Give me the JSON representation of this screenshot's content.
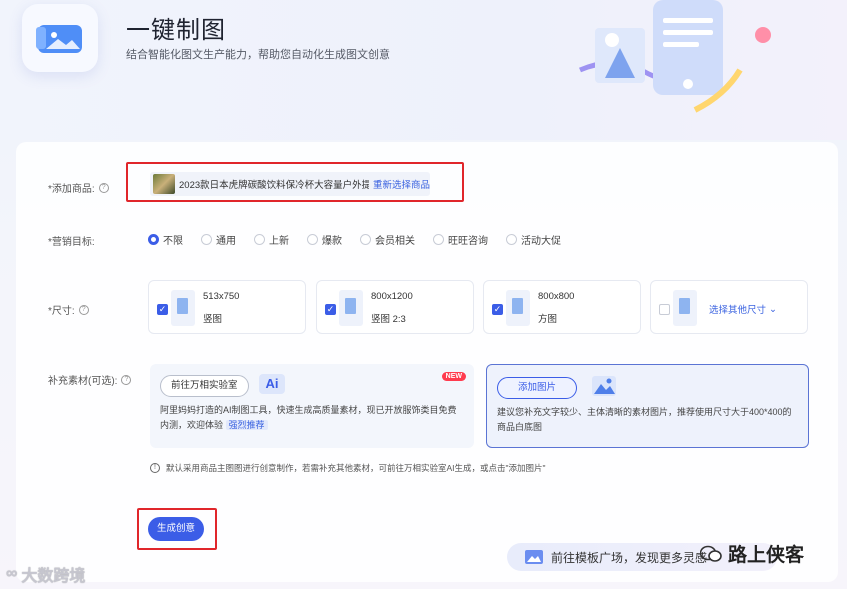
{
  "header": {
    "title": "一键制图",
    "subtitle": "结合智能化图文生产能力，帮助您自动化生成图文创意"
  },
  "product": {
    "label": "*添加商品:",
    "name": "2023款日本虎牌碳酸饮料保冷杯大容量户外提...",
    "reselect": "重新选择商品"
  },
  "goal": {
    "label": "*营销目标:",
    "options": [
      "不限",
      "通用",
      "上新",
      "爆款",
      "会员相关",
      "旺旺咨询",
      "活动大促"
    ],
    "selected": "不限"
  },
  "size": {
    "label": "*尺寸:",
    "options": [
      {
        "dim": "513x750",
        "kind": "竖图",
        "checked": true
      },
      {
        "dim": "800x1200",
        "kind": "竖图 2:3",
        "checked": true
      },
      {
        "dim": "800x800",
        "kind": "方图",
        "checked": true
      }
    ],
    "other": "选择其他尺寸"
  },
  "supplement": {
    "label": "补充素材(可选):",
    "lab_button": "前往万相实验室",
    "ai_text": "Ai",
    "new_badge": "NEW",
    "lab_desc": "阿里妈妈打造的AI制图工具，快速生成高质量素材，现已开放服饰类目免费内测，欢迎体验",
    "recommend": "强烈推荐",
    "add_button": "添加图片",
    "add_desc": "建议您补充文字较少、主体清晰的素材图片，推荐使用尺寸大于400*400的商品白底图"
  },
  "note": "默认采用商品主图图进行创意制作，若需补充其他素材，可前往万相实验室AI生成，或点击\"添加图片\"",
  "generate": "生成创意",
  "template_banner": "前往模板广场，发现更多灵感",
  "watermark_wechat": "路上侠客",
  "watermark_corner": "大数跨境",
  "colors": {
    "accent": "#3b5de7",
    "highlight": "#e0262b"
  }
}
